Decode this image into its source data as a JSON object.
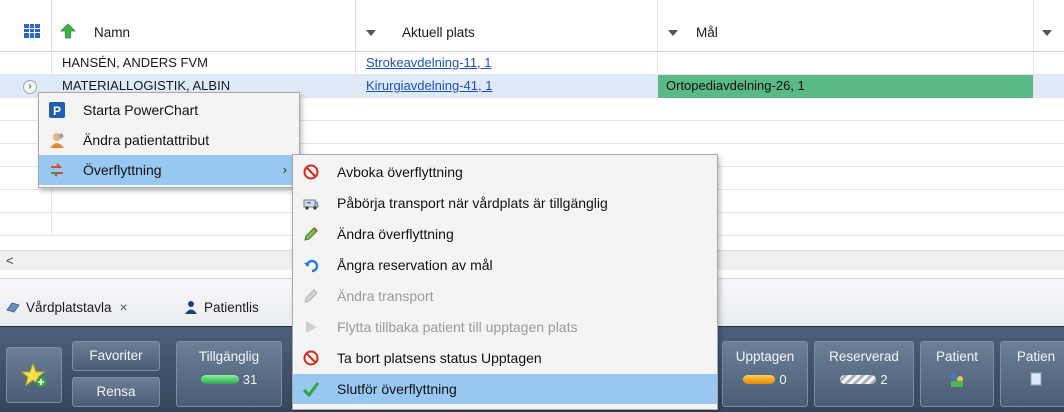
{
  "grid": {
    "columns": [
      {
        "label": "Namn"
      },
      {
        "label": "Aktuell plats"
      },
      {
        "label": "Mål"
      }
    ],
    "rows": [
      {
        "name": "HANSÉN, ANDERS FVM",
        "location": "Strokeavdelning-11, 1",
        "destination": ""
      },
      {
        "name": "MATERIALLOGISTIK, ALBIN",
        "location": "Kirurgiavdelning-41, 1",
        "destination": "Ortopediavdelning-26, 1"
      }
    ]
  },
  "tabs": [
    {
      "label": "Vårdplatstavla",
      "close": "×"
    },
    {
      "label": "Patientlis"
    }
  ],
  "toolbar": {
    "favorites_label": "Favoriter",
    "clear_label": "Rensa",
    "available": {
      "label": "Tillgänglig",
      "count": "31"
    },
    "occupied": {
      "label": "Upptagen",
      "count": "0"
    },
    "reserved": {
      "label": "Reserverad",
      "count": "2"
    },
    "patient": {
      "label": "Patient"
    },
    "patient2": {
      "label": "Patien"
    }
  },
  "context_menu": {
    "items": [
      {
        "label": "Starta PowerChart",
        "icon": "powerchart-icon"
      },
      {
        "label": "Ändra patientattribut",
        "icon": "person-icon"
      },
      {
        "label": "Överflyttning",
        "icon": "transfer-icon",
        "submenu": "›"
      }
    ]
  },
  "submenu": {
    "items": [
      {
        "label": "Avboka överflyttning",
        "icon": "no-entry-icon"
      },
      {
        "label": "Påbörja transport när vårdplats är tillgänglig",
        "icon": "ambulance-icon"
      },
      {
        "label": "Ändra överflyttning",
        "icon": "pencil-icon"
      },
      {
        "label": "Ångra reservation av mål",
        "icon": "undo-icon"
      },
      {
        "label": "Ändra transport",
        "icon": "pencil-icon"
      },
      {
        "label": "Flytta tillbaka patient till upptagen plats",
        "icon": "play-icon"
      },
      {
        "label": "Ta bort platsens status Upptagen",
        "icon": "no-entry-icon"
      },
      {
        "label": "Slutför överflyttning",
        "icon": "checkmark-icon"
      }
    ]
  },
  "colors": {
    "destination_fill": "#5ab986",
    "link": "#1d4fbf",
    "menu_highlight": "#98c8f2",
    "available_pill": "#3cc46a",
    "occupied_pill": "#f59b12",
    "toolbar_bg": "#3f5168"
  }
}
